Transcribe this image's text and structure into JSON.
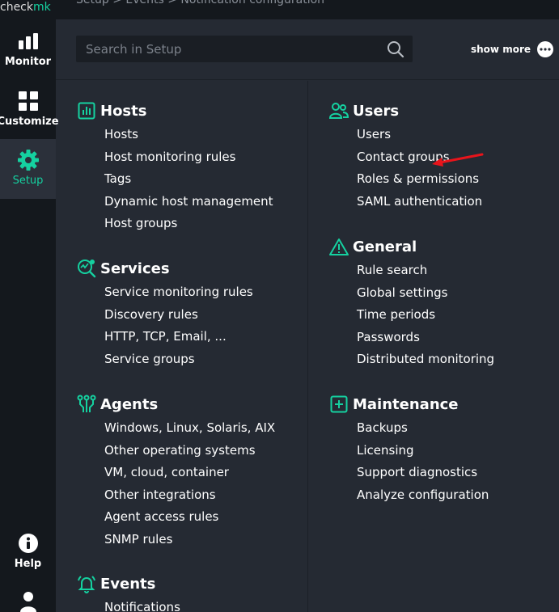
{
  "app": {
    "logo_part1": "check",
    "logo_part2": "mk",
    "breadcrumb": "Setup > Events > Notification configuration"
  },
  "sidebar": {
    "items": [
      {
        "label": "Monitor",
        "icon": "bar-chart-icon"
      },
      {
        "label": "Customize",
        "icon": "grid-icon"
      },
      {
        "label": "Setup",
        "icon": "gear-icon",
        "active": true
      },
      {
        "label": "Help",
        "icon": "info-icon"
      },
      {
        "label": "",
        "icon": "user-icon"
      }
    ]
  },
  "search": {
    "placeholder": "Search in Setup",
    "value": ""
  },
  "show_more": {
    "label": "show more",
    "icon": "more-dots-icon"
  },
  "sections": {
    "hosts": {
      "title": "Hosts",
      "icon": "hosts-icon",
      "items": [
        "Hosts",
        "Host monitoring rules",
        "Tags",
        "Dynamic host management",
        "Host groups"
      ]
    },
    "services": {
      "title": "Services",
      "icon": "services-icon",
      "items": [
        "Service monitoring rules",
        "Discovery rules",
        "HTTP, TCP, Email, ...",
        "Service groups"
      ]
    },
    "agents": {
      "title": "Agents",
      "icon": "agents-icon",
      "items": [
        "Windows, Linux, Solaris, AIX",
        "Other operating systems",
        "VM, cloud, container",
        "Other integrations",
        "Agent access rules",
        "SNMP rules"
      ]
    },
    "events": {
      "title": "Events",
      "icon": "bell-icon",
      "items": [
        "Notifications"
      ]
    },
    "users": {
      "title": "Users",
      "icon": "users-icon",
      "items": [
        "Users",
        "Contact groups",
        "Roles & permissions",
        "SAML authentication"
      ]
    },
    "general": {
      "title": "General",
      "icon": "warning-icon",
      "items": [
        "Rule search",
        "Global settings",
        "Time periods",
        "Passwords",
        "Distributed monitoring"
      ]
    },
    "maintenance": {
      "title": "Maintenance",
      "icon": "maintenance-icon",
      "items": [
        "Backups",
        "Licensing",
        "Support diagnostics",
        "Analyze configuration"
      ]
    }
  },
  "colors": {
    "accent": "#15d1a0",
    "sidebar_bg": "#14181d",
    "main_bg": "#252a33",
    "annotation_arrow": "#e8141b"
  }
}
